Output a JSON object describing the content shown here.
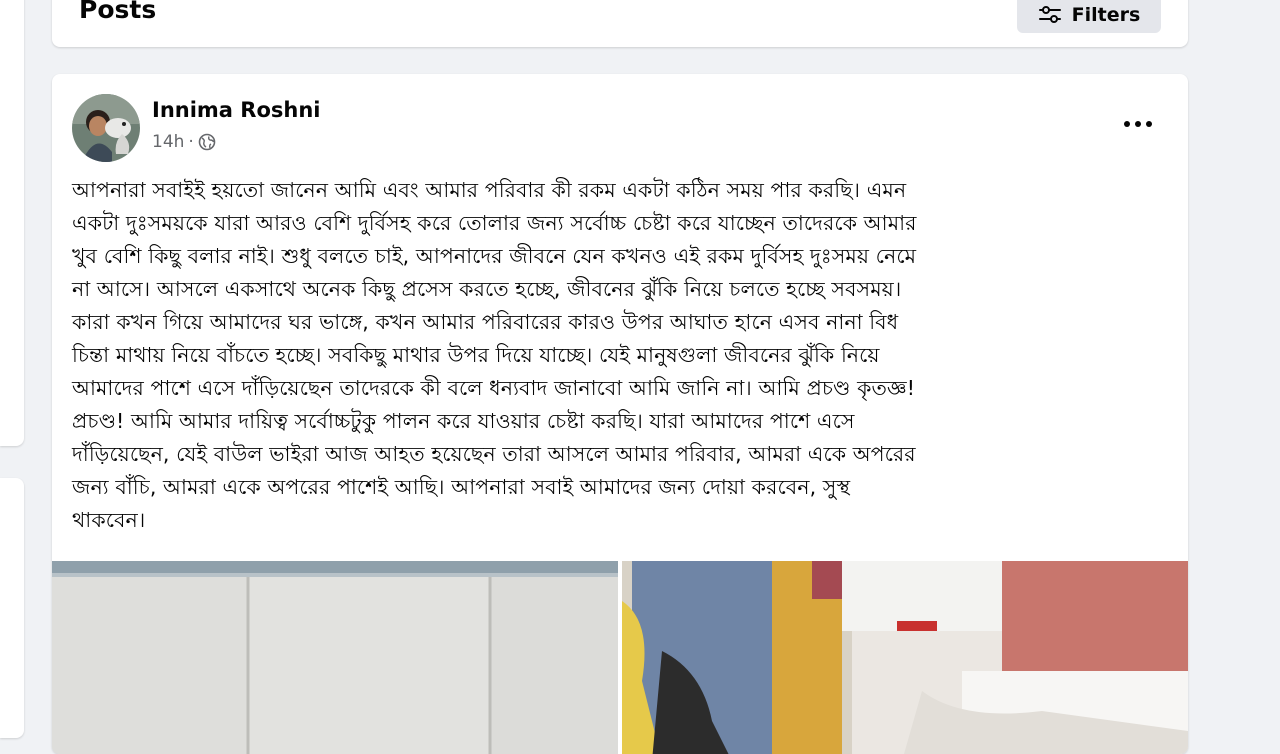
{
  "posts_header": {
    "title": "Posts",
    "filters_label": "Filters"
  },
  "post": {
    "author": "Innima Roshni",
    "time": "14h",
    "separator": "·",
    "audience_icon": "globe-icon",
    "more_icon": "more-horizontal-icon",
    "text": "আপনারা সবাইই হয়তো জানেন আমি এবং আমার পরিবার কী রকম একটা কঠিন সময় পার করছি। এমন\nএকটা দুঃসময়কে যারা আরও বেশি দুর্বিসহ করে তোলার জন্য সর্বোচ্চ চেষ্টা করে যাচ্ছেন তাদেরকে আমার\nখুব বেশি কিছু বলার নাই। শুধু বলতে চাই, আপনাদের জীবনে যেন কখনও এই রকম দুর্বিসহ দুঃসময় নেমে\nনা আসে। আসলে একসাথে অনেক কিছু প্রসেস করতে হচ্ছে, জীবনের ঝুঁকি নিয়ে চলতে হচ্ছে সবসময়।\nকারা কখন গিয়ে আমাদের ঘর ভাঙ্গে, কখন আমার পরিবারের কারও উপর আঘাত হানে এসব নানা বিধ\nচিন্তা মাথায় নিয়ে বাঁচতে হচ্ছে। সবকিছু মাথার উপর দিয়ে যাচ্ছে। যেই মানুষগুলা জীবনের ঝুঁকি নিয়ে\nআমাদের পাশে এসে দাঁড়িয়েছেন তাদেরকে কী বলে ধন্যবাদ জানাবো আমি জানি না। আমি প্রচণ্ড কৃতজ্ঞ!\nপ্রচণ্ড! আমি আমার দায়িত্ব সর্বোচ্চটুকু পালন করে যাওয়ার চেষ্টা করছি। যারা আমাদের পাশে এসে\nদাঁড়িয়েছেন, যেই বাউল ভাইরা আজ আহত হয়েছেন তারা আসলে আমার পরিবার, আমরা একে অপরের\nজন্য বাঁচি, আমরা একে অপরের পাশেই আছি। আপনারা সবাই আমাদের জন্য দোয়া করবেন, সুস্থ\nথাকবেন।"
  },
  "colors": {
    "page_bg": "#f0f2f5",
    "card_bg": "#ffffff",
    "text_primary": "#050505",
    "text_secondary": "#65676b",
    "button_bg": "#e4e6eb"
  }
}
